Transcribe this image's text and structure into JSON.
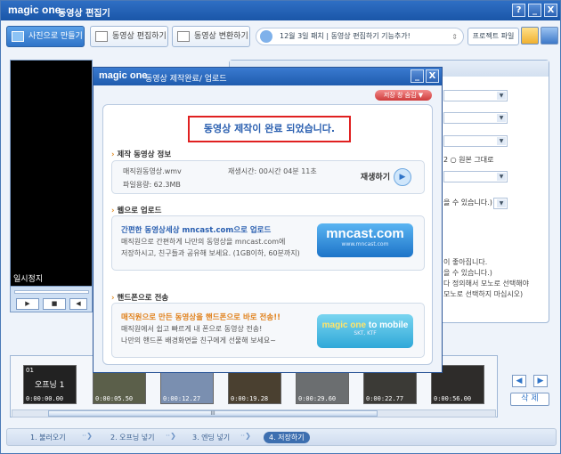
{
  "titlebar": {
    "logo": "magic one",
    "title": "동영상 편집기",
    "help": "?",
    "minimize": "_",
    "close": "X"
  },
  "tabs": [
    {
      "label": "사진으로 만들기",
      "active": true
    },
    {
      "label": "동영상 편집하기",
      "active": false
    },
    {
      "label": "동영상 변환하기",
      "active": false
    }
  ],
  "notice": {
    "text": "12월 3일 패치  |  동영상 편집하기 기능추가!",
    "scroll": "⇕"
  },
  "toolbar": {
    "project_label": "프로젝트 파일"
  },
  "preview": {
    "status": "일시정지"
  },
  "right_panel": {
    "radio_label": "원본 그대로",
    "radio_prefix": "2",
    "note1": "을 수 있습니다.)",
    "text_lines": [
      "이 좋아집니다.",
      "을 수 있습니다.)",
      "다 정의해서 모노로 선택해야",
      "모노로 선택하지 마십시오)"
    ]
  },
  "filmstrip": {
    "thumbs": [
      {
        "title": "오프닝 1",
        "tc": "0:00:00.00",
        "num": "01"
      },
      {
        "tc": "0:00:05.50"
      },
      {
        "tc": "0:00:12.27"
      },
      {
        "tc": "0:00:19.28"
      },
      {
        "tc": "0:00:29.60"
      },
      {
        "tc": "0:00:22.77"
      },
      {
        "tc": "0:00:56.00"
      }
    ],
    "scroll_grip": "III"
  },
  "side": {
    "prev": "◀",
    "next": "▶",
    "delete": "삭 제"
  },
  "steps": [
    {
      "label": "1. 불러오기",
      "active": false
    },
    {
      "label": "2. 오프닝 넣기",
      "active": false
    },
    {
      "label": "3. 엔딩 넣기",
      "active": false
    },
    {
      "label": "4. 저장하기",
      "active": true
    }
  ],
  "modal": {
    "logo": "magic one",
    "title": "동영상 제작완료/ 업로드",
    "save_button": "저장 창 숨김 ▼",
    "complete": "동영상 제작이 완료 되었습니다.",
    "info": {
      "heading": "제작 동영상 정보",
      "filename": "매직원동영상.wmv",
      "playtime": "재생시간: 00시간 04분 11초",
      "filesize": "파일용량: 62.3MB",
      "play": "재생하기"
    },
    "web": {
      "heading": "웹으로 업로드",
      "headline": "간편한 동영상세상 mncast.com으로 업로드",
      "body1": "매직원으로 간편하게 나만의 동영상을 mncast.com에",
      "body2": "저장하시고,  친구들과 공유해 보세요. (1GB이하, 60분까지)",
      "logo": "mncast.com",
      "url": "www.mncast.com"
    },
    "phone": {
      "heading": "핸드폰으로 전송",
      "headline": "매직원으로 만든 동영상을 핸드폰으로 바로 전송!!",
      "body1": "매직원에서 쉽고 빠르게 내 폰으로 동영상 전송!",
      "body2": "나만의 핸드폰 배경화면을 친구에게 선물해 보세요~",
      "logo_a": "magic one",
      "logo_b": "to mobile",
      "logo_sub": "SKT, KTF"
    }
  }
}
